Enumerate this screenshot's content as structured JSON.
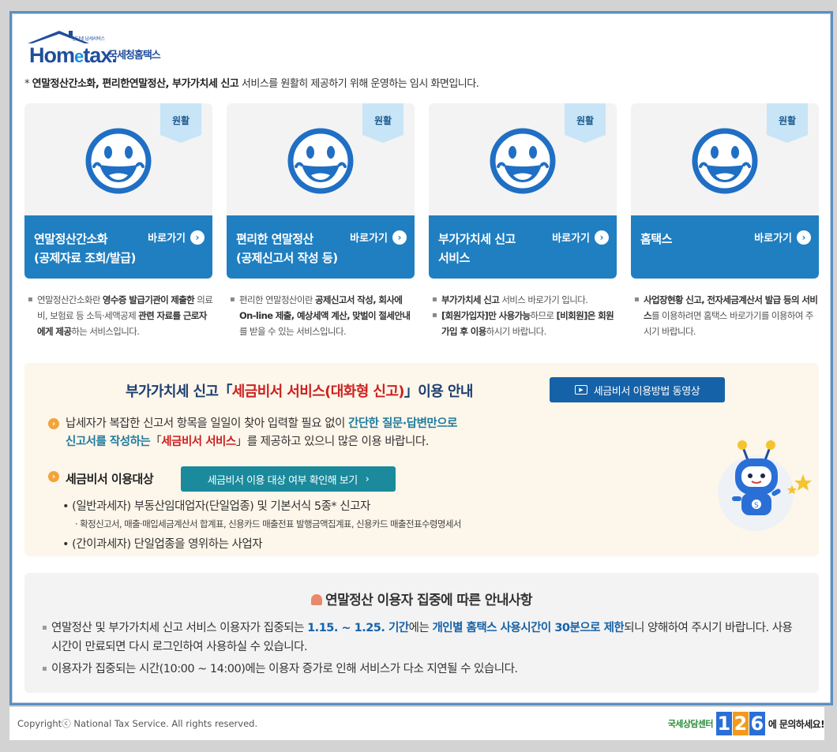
{
  "logo": {
    "en_main": "Hom",
    "en_e": "e",
    "en_rest": "tax.",
    "ko": "국세청홈택스",
    "small": "인터넷 납세서비스"
  },
  "notice": {
    "prefix": "* ",
    "bold": "연말정산간소화, 편리한연말정산, 부가가치세 신고",
    "rest": " 서비스를 원활히 제공하기 위해 운영하는 임시 화면입니다."
  },
  "cards": [
    {
      "badge": "원활",
      "title1": "연말정산간소화",
      "title2": "(공제자료 조회/발급)",
      "go": "바로가기",
      "desc": [
        {
          "pre": "연말정산간소화란 ",
          "b1": "영수증 발급기관이",
          "mid": " ",
          "b2": "제출한",
          "post": " 의료비, 보험료 등 소득·세액공제 ",
          "b3": "관련 자료를 근로자에게 제공",
          "end": "하는 서비스입니다."
        }
      ]
    },
    {
      "badge": "원활",
      "title1": "편리한 연말정산",
      "title2": "(공제신고서 작성 등)",
      "go": "바로가기",
      "desc": [
        {
          "pre": "편리한 연말정산이란 ",
          "b1": "공제신고서 작성, 회사에 On-line 제출, 예상세액 계산,",
          "mid": " ",
          "b2": "맞벌이 절세안내",
          "post": "를 받을 수 있는 서비스입니다.",
          "b3": "",
          "end": ""
        }
      ]
    },
    {
      "badge": "원활",
      "title1": "부가가치세 신고",
      "title2": "서비스",
      "go": "바로가기",
      "desc": [
        {
          "pre": "",
          "b1": "부가가치세 신고",
          "mid": "",
          "b2": "",
          "post": " 서비스 바로가기 입니다.",
          "b3": "",
          "end": ""
        },
        {
          "pre": "",
          "b1": "[회원가입자]만 사용가능",
          "mid": "",
          "b2": "",
          "post": "하므로 ",
          "b3": "[비회원]은 회원가입 후 이용",
          "end": "하시기 바랍니다."
        }
      ]
    },
    {
      "badge": "원활",
      "title1": "홈택스",
      "title2": "",
      "go": "바로가기",
      "desc": [
        {
          "pre": "",
          "b1": "사업장현황 신고, 전자세금계산서 발급 등의 서비스",
          "mid": "",
          "b2": "",
          "post": "를 이용하려면 홈택스 바로가기를 이용하여 주시기 바랍니다.",
          "b3": "",
          "end": ""
        }
      ]
    }
  ],
  "vat": {
    "head_pre": "부가가치세 신고「",
    "head_red": "세금비서 서비스(대화형 신고)",
    "head_post": "」이용 안내",
    "video_btn": "세금비서 이용방법 동영상",
    "line1_pre": "납세자가 복잡한 신고서 항목을 일일이 찾아 입력할 필요 없이 ",
    "line1_teal": "간단한 질문·답변만으로",
    "line2_teal": "신고서를 작성하는",
    "line2_mid": "「",
    "line2_red": "세금비서 서비스",
    "line2_post": "」를 제공하고 있으니 많은 이용 바랍니다.",
    "target_label": "세금비서 이용대상",
    "check_btn": "세금비서 이용 대상 여부 확인해 보기",
    "check_arrow": "›",
    "sub1": "• (일반과세자) 부동산임대업자(단일업종) 및 기본서식 5종* 신고자",
    "sub1_small": "· 확정신고서, 매출·매입세금계산서 합계표, 신용카드 매출전표 발행금액집계표, 신용카드 매출전표수령명세서",
    "sub2": "• (간이과세자) 단일업종을 영위하는 사업자"
  },
  "yearend": {
    "head": "연말정산 이용자 집중에 따른 안내사항",
    "p1_pre": "연말정산 및 부가가치세 신고 서비스 이용자가 집중되는 ",
    "p1_b1": "1.15. ~ 1.25. 기간",
    "p1_mid": "에는 ",
    "p1_b2": "개인별 홈택스 사용시간이 30분으로 제한",
    "p1_post": "되니 양해하여 주시기 바랍니다. 사용시간이 만료되면 다시 로그인하여 사용하실 수 있습니다.",
    "p2": "이용자가 집중되는 시간(10:00 ~ 14:00)에는 이용자 증가로 인해 서비스가 다소 지연될 수 있습니다."
  },
  "footer": {
    "copyright": "Copyrightⓒ National Tax Service. All rights reserved.",
    "call_label": "국세상담센터",
    "call_digits": [
      "1",
      "2",
      "6"
    ],
    "call_suffix": "에 문의하세요!"
  },
  "colors": {
    "primary_blue": "#1f7fc1",
    "badge_bg": "#c7e5f7",
    "red": "#cc2020",
    "teal": "#1a8a9c",
    "frame": "#5b8fc0"
  }
}
